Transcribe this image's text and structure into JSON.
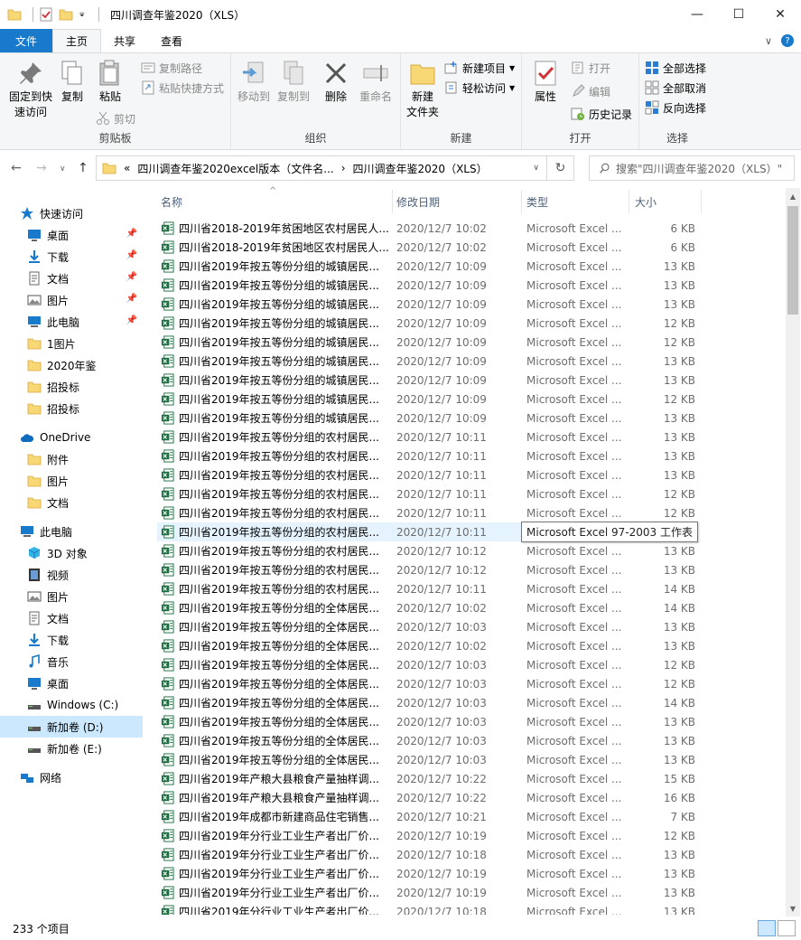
{
  "window": {
    "title": "四川调查年鉴2020（XLS）",
    "minimize": "—",
    "maximize": "☐",
    "close": "✕"
  },
  "tabs": {
    "file": "文件",
    "home": "主页",
    "share": "共享",
    "view": "查看",
    "expand": "∨",
    "help": "?"
  },
  "ribbon": {
    "clipboard": {
      "label": "剪贴板",
      "pin": "固定到快\n速访问",
      "copy": "复制",
      "paste": "粘贴",
      "copy_path": "复制路径",
      "paste_shortcut": "粘贴快捷方式",
      "cut": "剪切"
    },
    "organize": {
      "label": "组织",
      "move_to": "移动到",
      "copy_to": "复制到",
      "delete": "删除",
      "rename": "重命名"
    },
    "new": {
      "label": "新建",
      "new_folder": "新建\n文件夹",
      "new_item": "新建项目",
      "easy_access": "轻松访问"
    },
    "open": {
      "label": "打开",
      "properties": "属性",
      "open": "打开",
      "edit": "编辑",
      "history": "历史记录"
    },
    "select": {
      "label": "选择",
      "select_all": "全部选择",
      "select_none": "全部取消",
      "invert": "反向选择"
    }
  },
  "address": {
    "back": "←",
    "forward": "→",
    "down": "∨",
    "up": "↑",
    "prefix": "«",
    "crumb1": "四川调查年鉴2020excel版本（文件名...",
    "sep": "›",
    "crumb2": "四川调查年鉴2020（XLS）",
    "refresh": "↻",
    "search_placeholder": "搜索\"四川调查年鉴2020（XLS）\""
  },
  "sidebar": [
    {
      "label": "快速访问",
      "icon": "star-icon",
      "pinned": false
    },
    {
      "label": "桌面",
      "icon": "desktop-icon",
      "pinned": true
    },
    {
      "label": "下载",
      "icon": "download-icon",
      "pinned": true
    },
    {
      "label": "文档",
      "icon": "document-icon",
      "pinned": true
    },
    {
      "label": "图片",
      "icon": "picture-icon",
      "pinned": true
    },
    {
      "label": "此电脑",
      "icon": "computer-icon",
      "pinned": true
    },
    {
      "label": "1图片",
      "icon": "folder-icon",
      "pinned": false
    },
    {
      "label": "2020年鉴",
      "icon": "folder-icon",
      "pinned": false
    },
    {
      "label": "招投标",
      "icon": "folder-icon",
      "pinned": false
    },
    {
      "label": "招投标",
      "icon": "folder-icon",
      "pinned": false
    },
    {
      "label": "OneDrive",
      "icon": "cloud-icon",
      "pinned": false
    },
    {
      "label": "附件",
      "icon": "folder-icon",
      "pinned": false
    },
    {
      "label": "图片",
      "icon": "folder-icon",
      "pinned": false
    },
    {
      "label": "文档",
      "icon": "folder-icon",
      "pinned": false
    },
    {
      "label": "此电脑",
      "icon": "computer-icon",
      "pinned": false
    },
    {
      "label": "3D 对象",
      "icon": "cube-icon",
      "pinned": false
    },
    {
      "label": "视频",
      "icon": "video-icon",
      "pinned": false
    },
    {
      "label": "图片",
      "icon": "picture-icon",
      "pinned": false
    },
    {
      "label": "文档",
      "icon": "document-icon",
      "pinned": false
    },
    {
      "label": "下载",
      "icon": "download-icon",
      "pinned": false
    },
    {
      "label": "音乐",
      "icon": "music-icon",
      "pinned": false
    },
    {
      "label": "桌面",
      "icon": "desktop-icon",
      "pinned": false
    },
    {
      "label": "Windows (C:)",
      "icon": "drive-icon",
      "pinned": false
    },
    {
      "label": "新加卷 (D:)",
      "icon": "drive-icon",
      "pinned": false,
      "selected": true
    },
    {
      "label": "新加卷 (E:)",
      "icon": "drive-icon",
      "pinned": false
    },
    {
      "label": "网络",
      "icon": "network-icon",
      "pinned": false
    }
  ],
  "list": {
    "columns": {
      "name": "名称",
      "date": "修改日期",
      "type": "类型",
      "size": "大小",
      "sort_indicator": "^"
    },
    "tooltip": "Microsoft Excel 97-2003 工作表",
    "rows": [
      {
        "name": "四川省2018-2019年贫困地区农村居民人...",
        "date": "2020/12/7 10:02",
        "type": "Microsoft Excel ...",
        "size": "6 KB"
      },
      {
        "name": "四川省2018-2019年贫困地区农村居民人...",
        "date": "2020/12/7 10:02",
        "type": "Microsoft Excel ...",
        "size": "6 KB"
      },
      {
        "name": "四川省2019年按五等份分组的城镇居民...",
        "date": "2020/12/7 10:09",
        "type": "Microsoft Excel ...",
        "size": "13 KB"
      },
      {
        "name": "四川省2019年按五等份分组的城镇居民...",
        "date": "2020/12/7 10:09",
        "type": "Microsoft Excel ...",
        "size": "13 KB"
      },
      {
        "name": "四川省2019年按五等份分组的城镇居民...",
        "date": "2020/12/7 10:09",
        "type": "Microsoft Excel ...",
        "size": "13 KB"
      },
      {
        "name": "四川省2019年按五等份分组的城镇居民...",
        "date": "2020/12/7 10:09",
        "type": "Microsoft Excel ...",
        "size": "12 KB"
      },
      {
        "name": "四川省2019年按五等份分组的城镇居民...",
        "date": "2020/12/7 10:09",
        "type": "Microsoft Excel ...",
        "size": "12 KB"
      },
      {
        "name": "四川省2019年按五等份分组的城镇居民...",
        "date": "2020/12/7 10:09",
        "type": "Microsoft Excel ...",
        "size": "13 KB"
      },
      {
        "name": "四川省2019年按五等份分组的城镇居民...",
        "date": "2020/12/7 10:09",
        "type": "Microsoft Excel ...",
        "size": "13 KB"
      },
      {
        "name": "四川省2019年按五等份分组的城镇居民...",
        "date": "2020/12/7 10:09",
        "type": "Microsoft Excel ...",
        "size": "12 KB"
      },
      {
        "name": "四川省2019年按五等份分组的城镇居民...",
        "date": "2020/12/7 10:09",
        "type": "Microsoft Excel ...",
        "size": "13 KB"
      },
      {
        "name": "四川省2019年按五等份分组的农村居民...",
        "date": "2020/12/7 10:11",
        "type": "Microsoft Excel ...",
        "size": "13 KB"
      },
      {
        "name": "四川省2019年按五等份分组的农村居民...",
        "date": "2020/12/7 10:11",
        "type": "Microsoft Excel ...",
        "size": "13 KB"
      },
      {
        "name": "四川省2019年按五等份分组的农村居民...",
        "date": "2020/12/7 10:11",
        "type": "Microsoft Excel ...",
        "size": "13 KB"
      },
      {
        "name": "四川省2019年按五等份分组的农村居民...",
        "date": "2020/12/7 10:11",
        "type": "Microsoft Excel ...",
        "size": "12 KB"
      },
      {
        "name": "四川省2019年按五等份分组的农村居民...",
        "date": "2020/12/7 10:11",
        "type": "Microsoft Excel ...",
        "size": "12 KB"
      },
      {
        "name": "四川省2019年按五等份分组的农村居民...",
        "date": "2020/12/7 10:11",
        "type": "",
        "size": "",
        "hover": true
      },
      {
        "name": "四川省2019年按五等份分组的农村居民...",
        "date": "2020/12/7 10:12",
        "type": "Microsoft Excel ...",
        "size": "13 KB"
      },
      {
        "name": "四川省2019年按五等份分组的农村居民...",
        "date": "2020/12/7 10:12",
        "type": "Microsoft Excel ...",
        "size": "13 KB"
      },
      {
        "name": "四川省2019年按五等份分组的农村居民...",
        "date": "2020/12/7 10:11",
        "type": "Microsoft Excel ...",
        "size": "14 KB"
      },
      {
        "name": "四川省2019年按五等份分组的全体居民...",
        "date": "2020/12/7 10:02",
        "type": "Microsoft Excel ...",
        "size": "14 KB"
      },
      {
        "name": "四川省2019年按五等份分组的全体居民...",
        "date": "2020/12/7 10:03",
        "type": "Microsoft Excel ...",
        "size": "13 KB"
      },
      {
        "name": "四川省2019年按五等份分组的全体居民...",
        "date": "2020/12/7 10:02",
        "type": "Microsoft Excel ...",
        "size": "13 KB"
      },
      {
        "name": "四川省2019年按五等份分组的全体居民...",
        "date": "2020/12/7 10:03",
        "type": "Microsoft Excel ...",
        "size": "12 KB"
      },
      {
        "name": "四川省2019年按五等份分组的全体居民...",
        "date": "2020/12/7 10:03",
        "type": "Microsoft Excel ...",
        "size": "12 KB"
      },
      {
        "name": "四川省2019年按五等份分组的全体居民...",
        "date": "2020/12/7 10:03",
        "type": "Microsoft Excel ...",
        "size": "14 KB"
      },
      {
        "name": "四川省2019年按五等份分组的全体居民...",
        "date": "2020/12/7 10:03",
        "type": "Microsoft Excel ...",
        "size": "13 KB"
      },
      {
        "name": "四川省2019年按五等份分组的全体居民...",
        "date": "2020/12/7 10:03",
        "type": "Microsoft Excel ...",
        "size": "13 KB"
      },
      {
        "name": "四川省2019年按五等份分组的全体居民...",
        "date": "2020/12/7 10:03",
        "type": "Microsoft Excel ...",
        "size": "13 KB"
      },
      {
        "name": "四川省2019年产粮大县粮食产量抽样调...",
        "date": "2020/12/7 10:22",
        "type": "Microsoft Excel ...",
        "size": "15 KB"
      },
      {
        "name": "四川省2019年产粮大县粮食产量抽样调...",
        "date": "2020/12/7 10:22",
        "type": "Microsoft Excel ...",
        "size": "16 KB"
      },
      {
        "name": "四川省2019年成都市新建商品住宅销售...",
        "date": "2020/12/7 10:21",
        "type": "Microsoft Excel ...",
        "size": "7 KB"
      },
      {
        "name": "四川省2019年分行业工业生产者出厂价...",
        "date": "2020/12/7 10:19",
        "type": "Microsoft Excel ...",
        "size": "12 KB"
      },
      {
        "name": "四川省2019年分行业工业生产者出厂价...",
        "date": "2020/12/7 10:18",
        "type": "Microsoft Excel ...",
        "size": "13 KB"
      },
      {
        "name": "四川省2019年分行业工业生产者出厂价...",
        "date": "2020/12/7 10:19",
        "type": "Microsoft Excel ...",
        "size": "13 KB"
      },
      {
        "name": "四川省2019年分行业工业生产者出厂价...",
        "date": "2020/12/7 10:19",
        "type": "Microsoft Excel ...",
        "size": "13 KB"
      },
      {
        "name": "四川省2019年分行业工业生产者出厂价...",
        "date": "2020/12/7 10:18",
        "type": "Microsoft Excel ...",
        "size": "13 KB"
      }
    ]
  },
  "status": {
    "count": "233 个项目"
  },
  "colors": {
    "accent": "#1979ca",
    "selected": "#cce8ff",
    "hover": "#e5f3ff",
    "excel_green": "#1d6f42",
    "folder_yellow": "#f8d775"
  }
}
